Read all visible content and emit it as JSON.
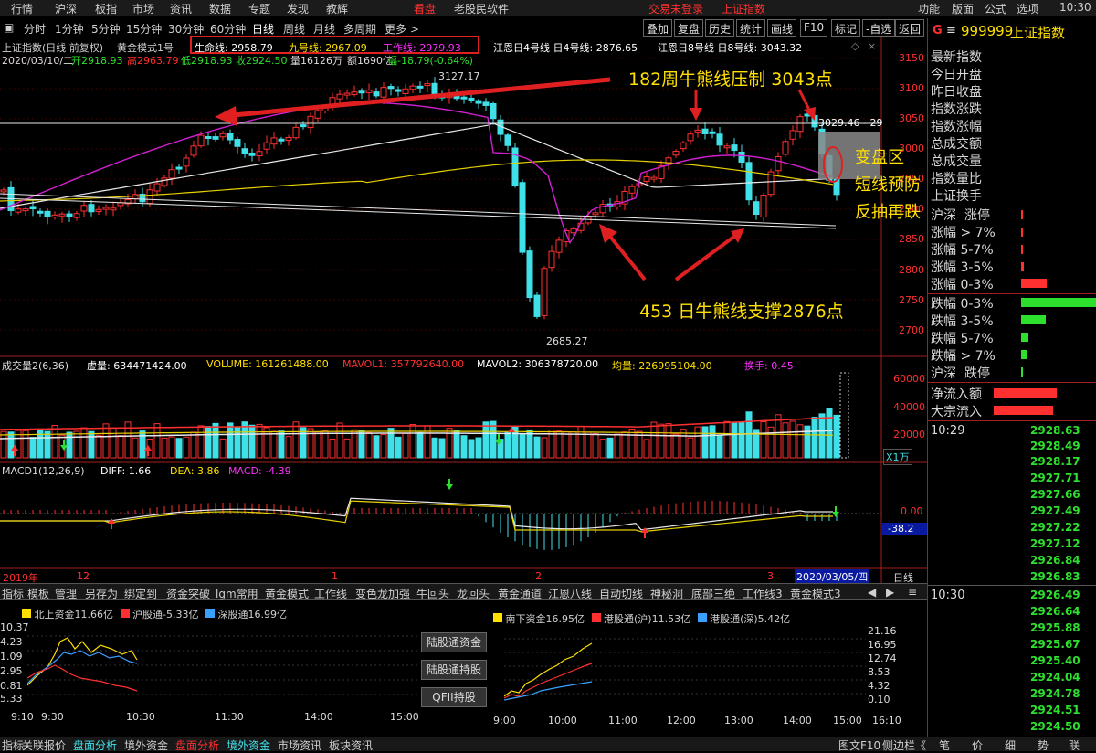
{
  "menu": {
    "left": [
      "行情",
      "沪深",
      "板指",
      "市场",
      "资讯",
      "数据",
      "专题",
      "发现",
      "教辉",
      "看盘",
      "老股民软件"
    ],
    "status": "交易未登录",
    "title": "上证指数",
    "right": [
      "功能",
      "版面",
      "公式",
      "选项"
    ],
    "clock": "10:30"
  },
  "period_tabs": [
    "分时",
    "1分钟",
    "5分钟",
    "15分钟",
    "30分钟",
    "60分钟",
    "日线",
    "周线",
    "月线",
    "多周期",
    "更多 >"
  ],
  "tool_buttons": [
    "叠加",
    "复盘",
    "历史",
    "统计",
    "画线",
    "F10",
    "标记",
    "-自选",
    "返回"
  ],
  "chart_header": {
    "name": "上证指数(日线 前复权)",
    "indicator": "黄金模式1号",
    "life_line": "生命线: 2958.79",
    "nine_line": "九号线: 2967.09",
    "work_line": "工作线: 2979.93",
    "jiangen4": "江恩日4号线 日4号线: 2876.65",
    "jiangen8": "江恩日8号线 日8号线: 3043.32"
  },
  "ohlc": {
    "date": "2020/03/10/二",
    "open": "开2918.93",
    "high": "高2963.79",
    "low": "低2918.93",
    "close": "收2924.50",
    "vol": "量16126万",
    "amt": "额1690亿",
    "chg": "幅-18.79(-0.64%)"
  },
  "price_axis": [
    "3150",
    "3100",
    "3050",
    "3000",
    "2950",
    "2900",
    "2850",
    "2800",
    "2750",
    "2700"
  ],
  "chart_labels": {
    "high": "3127.17",
    "low": "2685.27",
    "last": "3029.46 - 29"
  },
  "annotations": {
    "top": "182周牛熊线压制 3043点",
    "zone1": "变盘区",
    "zone2": "短线预防",
    "zone3": "反抽再跌",
    "bottom": "453 日牛熊线支撑2876点"
  },
  "volume_header": {
    "name": "成交量2(6,36)",
    "virtual": "虚量: 634471424.00",
    "volume": "VOLUME: 161261488.00",
    "mavol1": "MAVOL1: 357792640.00",
    "mavol2": "MAVOL2: 306378720.00",
    "avg": "均量: 226995104.00",
    "turnover": "换手: 0.45"
  },
  "volume_axis": [
    "60000",
    "40000",
    "20000"
  ],
  "volume_unit": "X1万",
  "macd_header": {
    "name": "MACD1(12,26,9)",
    "diff": "DIFF: 1.66",
    "dea": "DEA: 3.86",
    "macd": "MACD: -4.39"
  },
  "macd_axis": {
    "zero": "0.00",
    "value": "-38.2"
  },
  "date_axis": {
    "year": "2019年",
    "m12": "12",
    "m1": "1",
    "m2": "2",
    "m3": "3",
    "cursor": "2020/03/05/四",
    "period": "日线"
  },
  "indicator_tabs": [
    "指标",
    "模板",
    "管理",
    "另存为",
    "绑定到",
    "资金突破",
    "lgm常用",
    "黄金模式",
    "工作线",
    "变色龙加强",
    "牛回头",
    "龙回头",
    "黄金通道",
    "江恩八线",
    "自动切线",
    "神秘洞",
    "底部三绝",
    "工作线3",
    "黄金模式3"
  ],
  "north": {
    "legend1": "北上资金11.66亿",
    "legend2": "沪股通-5.33亿",
    "legend3": "深股通16.99亿",
    "yaxis": [
      "10.37",
      "4.23",
      "1.09",
      "2.95",
      "0.81",
      "5.33"
    ],
    "xaxis": [
      "9:10",
      "9:30",
      "10:30",
      "11:30",
      "14:00",
      "15:00"
    ]
  },
  "buttons": [
    "陆股通资金",
    "陆股通持股",
    "QFII持股"
  ],
  "south": {
    "legend1": "南下资金16.95亿",
    "legend2": "港股通(沪)11.53亿",
    "legend3": "港股通(深)5.42亿",
    "yaxis": [
      "21.16",
      "16.95",
      "12.74",
      "8.53",
      "4.32",
      "0.10"
    ],
    "xaxis": [
      "9:00",
      "10:00",
      "11:00",
      "12:00",
      "13:00",
      "14:00",
      "15:00",
      "16:10"
    ]
  },
  "bottom_tabs": [
    "指标",
    "关联报价",
    "盘面分析",
    "境外资金",
    "盘面分析",
    "境外资金",
    "市场资讯",
    "板块资讯"
  ],
  "bottom_right": [
    "图文F10",
    "侧边栏《"
  ],
  "quote": {
    "badge": "G",
    "code": "999999",
    "name": "上证指数",
    "rows": [
      "最新指数",
      "今日开盘",
      "昨日收盘",
      "指数涨跌",
      "指数涨幅",
      "总成交额",
      "总成交量",
      "指数量比",
      "上证换手"
    ],
    "limit": [
      "沪深",
      "涨停"
    ],
    "up": [
      "涨幅 > 7%",
      "涨幅 5-7%",
      "涨幅 3-5%",
      "涨幅 0-3%"
    ],
    "down": [
      "跌幅 0-3%",
      "跌幅 3-5%",
      "跌幅 5-7%",
      "跌幅 > 7%"
    ],
    "limit2": [
      "沪深",
      "跌停"
    ],
    "flow": [
      "净流入额",
      "大宗流入"
    ]
  },
  "ticks": {
    "t1": "10:29",
    "t2": "10:30",
    "v1": [
      "2928.63",
      "2928.49",
      "2928.17",
      "2927.71",
      "2927.66",
      "2927.49",
      "2927.22",
      "2927.12",
      "2926.84",
      "2926.83"
    ],
    "v2": [
      "2926.49",
      "2926.64",
      "2925.88",
      "2925.67",
      "2925.40",
      "2924.04",
      "2924.78",
      "2924.51",
      "2924.50"
    ]
  },
  "side_bottom": [
    "笔",
    "价",
    "细",
    "势",
    "联"
  ],
  "colors": {
    "up": "#ff3030",
    "down": "#40e0e8",
    "yellow": "#ffe000",
    "magenta": "#ff30ff",
    "green": "#2ee02e"
  }
}
